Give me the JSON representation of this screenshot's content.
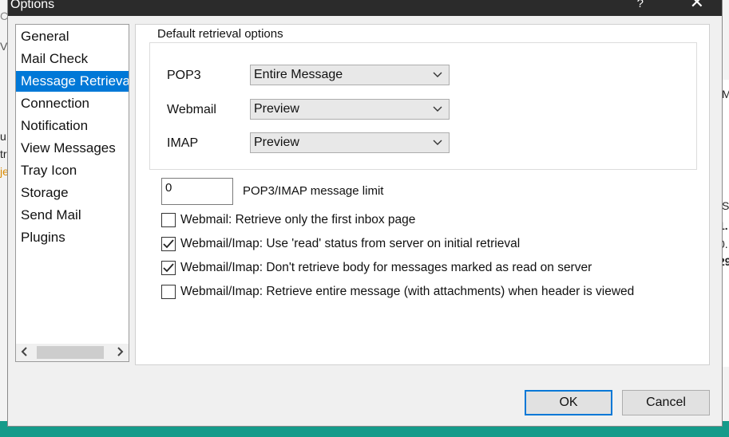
{
  "background": {
    "fragments": [
      {
        "text": "C",
        "class": "f1"
      },
      {
        "text": "V",
        "class": "f2"
      },
      {
        "text": "u",
        "class": "f3"
      },
      {
        "text": "tr",
        "class": "f4"
      },
      {
        "text": "je",
        "class": "f5"
      },
      {
        "text": "M",
        "class": "f6"
      },
      {
        "text": "S",
        "class": "f7"
      },
      {
        "text": "1.",
        "class": "f8"
      },
      {
        "text": "0.",
        "class": "f9"
      },
      {
        "text": "29",
        "class": "f10"
      }
    ]
  },
  "window": {
    "title": "Options",
    "help_label": "?",
    "close_label": "✕"
  },
  "nav": {
    "items": [
      {
        "label": "General",
        "selected": false
      },
      {
        "label": "Mail Check",
        "selected": false
      },
      {
        "label": "Message Retrieval",
        "selected": true
      },
      {
        "label": "Connection",
        "selected": false
      },
      {
        "label": "Notification",
        "selected": false
      },
      {
        "label": "View Messages",
        "selected": false
      },
      {
        "label": "Tray Icon",
        "selected": false
      },
      {
        "label": "Storage",
        "selected": false
      },
      {
        "label": "Send Mail",
        "selected": false
      },
      {
        "label": "Plugins",
        "selected": false
      }
    ],
    "scroll_left_icon": "chevron-left-icon",
    "scroll_right_icon": "chevron-right-icon"
  },
  "retrieval": {
    "group_title": "Default retrieval options",
    "pop3_label": "POP3",
    "pop3_value": "Entire Message",
    "webmail_label": "Webmail",
    "webmail_value": "Preview",
    "imap_label": "IMAP",
    "imap_value": "Preview",
    "message_limit_value": "0",
    "message_limit_label": "POP3/IMAP message limit",
    "checkboxes": [
      {
        "label": "Webmail: Retrieve only the first inbox page",
        "checked": false
      },
      {
        "label": "Webmail/Imap: Use 'read' status from server on initial retrieval",
        "checked": true
      },
      {
        "label": "Webmail/Imap: Don't retrieve body for messages marked as read on server",
        "checked": true
      },
      {
        "label": "Webmail/Imap: Retrieve entire message (with attachments) when header is viewed",
        "checked": false
      }
    ]
  },
  "buttons": {
    "ok_label": "OK",
    "cancel_label": "Cancel"
  },
  "colors": {
    "selection": "#0078d7",
    "titlebar": "#2b2b2b",
    "taskbar": "#159b8a"
  }
}
